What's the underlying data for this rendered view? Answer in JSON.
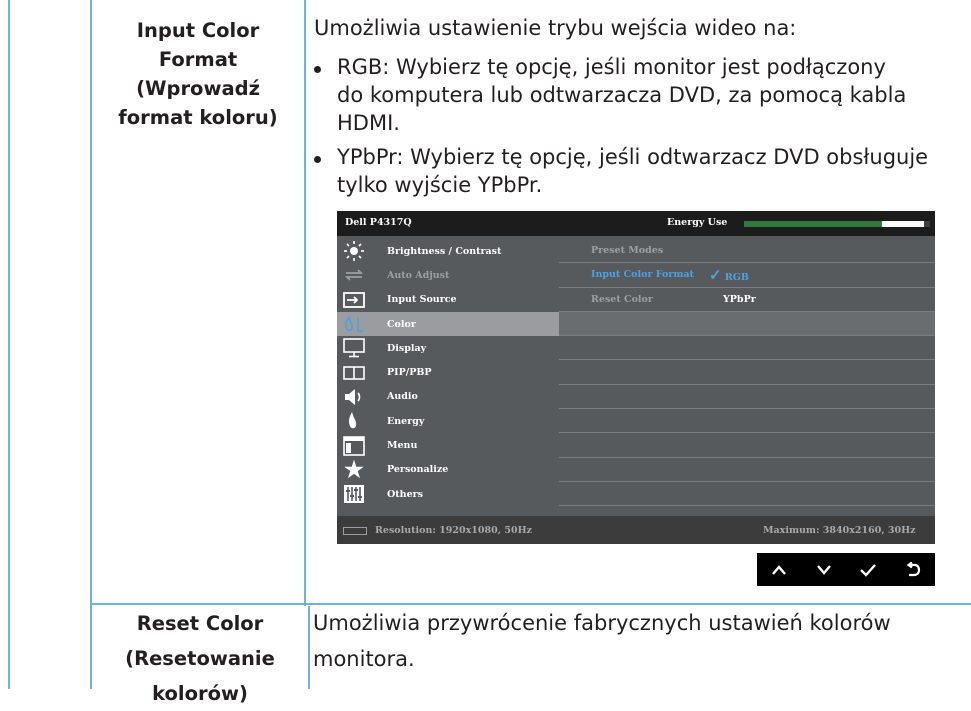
{
  "rows": [
    {
      "label_lines": [
        "Input Color",
        "Format",
        "(Wprowadź",
        "format koloru)"
      ],
      "intro": "Umożliwia ustawienie trybu wejścia wideo na:",
      "bullets": [
        {
          "lines": [
            "RGB: Wybierz tę opcję, jeśli monitor jest podłączony",
            "do komputera lub odtwarzacza DVD, za pomocą kabla",
            "HDMI."
          ]
        },
        {
          "lines": [
            "YPbPr: Wybierz tę opcję, jeśli odtwarzacz DVD obsługuje",
            "tylko wyjście YPbPr."
          ]
        }
      ]
    },
    {
      "label_lines": [
        "Reset Color",
        "(Resetowanie",
        "kolorów)"
      ],
      "desc_lines": [
        "Umożliwia przywrócenie fabrycznych ustawień kolorów",
        "monitora."
      ]
    }
  ],
  "osd": {
    "model": "Dell P4317Q",
    "energy_label": "Energy Use",
    "energy_level_fraction": 0.76,
    "menu": [
      {
        "label": "Brightness / Contrast",
        "icon": "sun-icon",
        "state": "normal"
      },
      {
        "label": "Auto Adjust",
        "icon": "auto-adjust-icon",
        "state": "dim"
      },
      {
        "label": "Input Source",
        "icon": "input-source-icon",
        "state": "normal"
      },
      {
        "label": "Color",
        "icon": "color-icon",
        "state": "selected"
      },
      {
        "label": "Display",
        "icon": "display-icon",
        "state": "normal"
      },
      {
        "label": "PIP/PBP",
        "icon": "pip-icon",
        "state": "normal"
      },
      {
        "label": "Audio",
        "icon": "speaker-icon",
        "state": "normal"
      },
      {
        "label": "Energy",
        "icon": "energy-icon",
        "state": "normal"
      },
      {
        "label": "Menu",
        "icon": "menu-icon",
        "state": "normal"
      },
      {
        "label": "Personalize",
        "icon": "star-icon",
        "state": "normal"
      },
      {
        "label": "Others",
        "icon": "others-icon",
        "state": "normal"
      }
    ],
    "submenu": [
      {
        "label": "Preset Modes",
        "value": "",
        "state": "dim"
      },
      {
        "label": "Input Color Format",
        "value": "RGB",
        "checked": true,
        "state": "selected"
      },
      {
        "label": "Reset Color",
        "value": "YPbPr",
        "state": "dim"
      }
    ],
    "resolution": "Resolution: 1920x1080, 50Hz",
    "maximum": "Maximum: 3840x2160, 30Hz",
    "buttons": [
      "up-icon",
      "down-icon",
      "check-icon",
      "back-icon"
    ],
    "colors": {
      "selected_bg": "#9a9ca0",
      "panel_bg": "#575a5d",
      "energy_fill": "#2e7a3c",
      "rule": "#6db3dc"
    }
  }
}
